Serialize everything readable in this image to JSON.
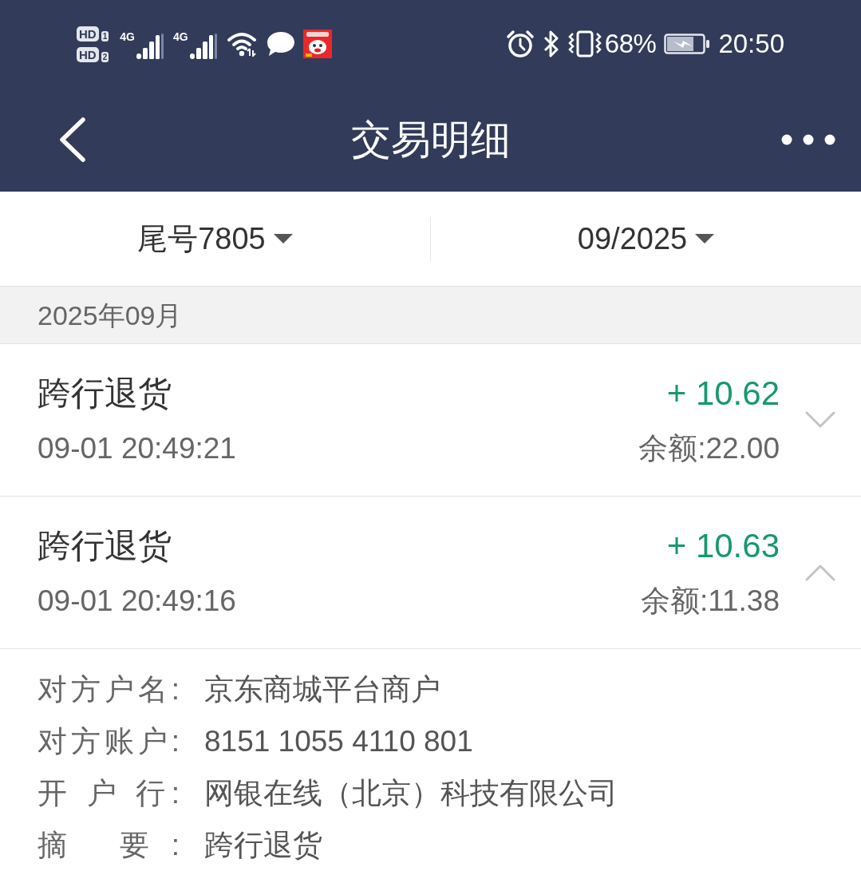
{
  "status_bar": {
    "sims": [
      {
        "badge": "HD",
        "slot": "1"
      },
      {
        "badge": "HD",
        "slot": "2"
      }
    ],
    "networks": [
      {
        "type": "4G"
      },
      {
        "type": "4G"
      }
    ],
    "battery_percent": "68%",
    "time": "20:50"
  },
  "header": {
    "title": "交易明细"
  },
  "filters": [
    {
      "label": "尾号7805"
    },
    {
      "label": "09/2025"
    }
  ],
  "section": {
    "title": "2025年09月"
  },
  "transactions": [
    {
      "title": "跨行退货",
      "time": "09-01 20:49:21",
      "amount": "+ 10.62",
      "balance": "余额:22.00",
      "expanded": false
    },
    {
      "title": "跨行退货",
      "time": "09-01 20:49:16",
      "amount": "+ 10.63",
      "balance": "余额:11.38",
      "expanded": true,
      "details": [
        {
          "label": "对方户名:",
          "value": "京东商城平台商户"
        },
        {
          "label": "对方账户:",
          "value": "8151 1055 4110 801"
        },
        {
          "label": "开 户 行:",
          "value": "网银在线（北京）科技有限公司"
        },
        {
          "label": "摘 要:",
          "value": "跨行退货"
        }
      ]
    }
  ]
}
